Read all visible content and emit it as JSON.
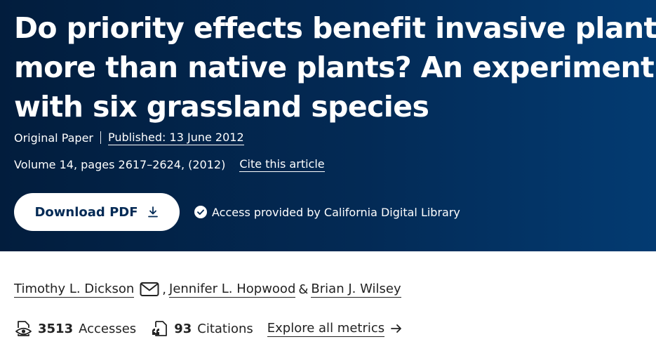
{
  "article": {
    "title_lines": [
      "Do priority effects benefit invasive plants",
      "more than native plants? An experiment",
      "with six grassland species"
    ],
    "type": "Original Paper",
    "published": "Published: 13 June 2012",
    "volume": "Volume 14, pages 2617–2624, (2012)",
    "cite_label": "Cite this article"
  },
  "actions": {
    "download_label": "Download PDF",
    "access_text": "Access provided by California Digital Library"
  },
  "authors": {
    "first": "Timothy L. Dickson",
    "separator": ",",
    "second": "Jennifer L. Hopwood",
    "conjunction": "&",
    "third": "Brian J. Wilsey"
  },
  "metrics": {
    "accesses_count": "3513",
    "accesses_label": "Accesses",
    "citations_count": "93",
    "citations_label": "Citations",
    "explore_label": "Explore all metrics"
  },
  "colors": {
    "hero_background": "#032a55",
    "hero_text": "#ffffff",
    "button_text": "#032a55",
    "body_text": "#222222"
  },
  "icons": {
    "download": "download-icon",
    "access": "check-circle-icon",
    "mail": "mail-icon",
    "accesses": "eye-document-icon",
    "citations": "quote-document-icon",
    "explore": "arrow-right-icon"
  }
}
